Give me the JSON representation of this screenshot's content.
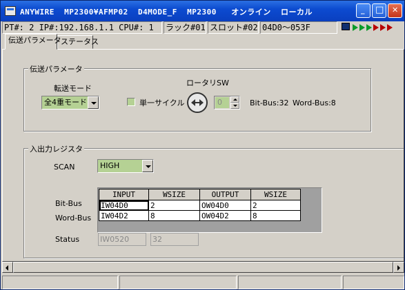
{
  "window": {
    "title": "ANYWIRE  MP2300¥AFMP02  D4MODE_F  MP2300   オンライン  ローカル",
    "minimize_label": "_",
    "maximize_label": "□",
    "close_label": "✕"
  },
  "status": {
    "pt_ip_cpu": "PT#: 2 IP#:192.168.1.1 CPU#: 1",
    "rack": "ラック#01",
    "slot": "スロット#02",
    "range": "04D0～053F"
  },
  "tabs": [
    {
      "label": "伝送パラメータ",
      "active": true
    },
    {
      "label": "ステータス",
      "active": false
    }
  ],
  "transmission": {
    "group_label": "伝送パラメータ",
    "transfer_mode_label": "転送モード",
    "transfer_mode_value": "全4重モード",
    "single_cycle_label": "単一サイクル",
    "rotary_label": "ロータリSW",
    "rotary_value": "0",
    "bitbus_info": "Bit-Bus:32",
    "wordbus_info": "Word-Bus:8"
  },
  "io_register": {
    "group_label": "入出力レジスタ",
    "scan_label": "SCAN",
    "scan_value": "HIGH",
    "columns": [
      "INPUT",
      "WSIZE",
      "OUTPUT",
      "WSIZE"
    ],
    "rows": [
      {
        "label": "Bit-Bus",
        "input": "IW04D0",
        "in_wsize": "2",
        "output": "OW04D0",
        "out_wsize": "2"
      },
      {
        "label": "Word-Bus",
        "input": "IW04D2",
        "in_wsize": "8",
        "output": "OW04D2",
        "out_wsize": "8"
      }
    ],
    "status_label": "Status",
    "status_register": "IW0520",
    "status_size": "32"
  },
  "colors": {
    "titlebar": "#0c4bd0",
    "control_face": "#d4d0c8",
    "field_green": "#b5d194"
  }
}
